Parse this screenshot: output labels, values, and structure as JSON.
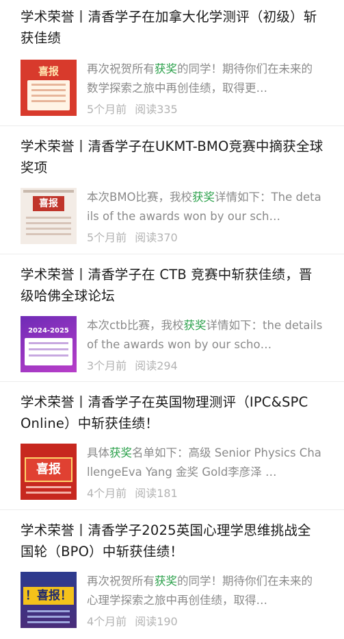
{
  "articles": [
    {
      "title": "学术荣誉丨清香学子在加拿大化学测评（初级）斩获佳绩",
      "summary_pre": "再次祝贺所有",
      "summary_hl": "获奖",
      "summary_post": "的同学！期待你们在未来的数学探索之旅中再创佳绩，取得更…",
      "time": "5个月前",
      "reads": "阅读335",
      "thumb_text": "喜报"
    },
    {
      "title": "学术荣誉丨清香学子在UKMT-BMO竞赛中摘获全球奖项",
      "summary_pre": "本次BMO比赛，我校",
      "summary_hl": "获奖",
      "summary_post": "详情如下：The details of the awards won by our sch…",
      "time": "5个月前",
      "reads": "阅读370",
      "thumb_text": "喜报"
    },
    {
      "title": "学术荣誉丨清香学子在 CTB 竞赛中斩获佳绩，晋级哈佛全球论坛",
      "summary_pre": "本次ctb比赛，我校",
      "summary_hl": "获奖",
      "summary_post": "详情如下：the details of the awards won by our scho…",
      "time": "3个月前",
      "reads": "阅读294",
      "thumb_text": "2024-2025"
    },
    {
      "title": "学术荣誉丨清香学子在英国物理测评（IPC&SPC Online）中斩获佳绩！",
      "summary_pre": "具体",
      "summary_hl": "获奖",
      "summary_post": "名单如下：高级 Senior Physics ChallengeEva Yang 金奖 Gold李彦泽 …",
      "time": "4个月前",
      "reads": "阅读181",
      "thumb_text": "喜报"
    },
    {
      "title": "学术荣誉丨清香学子2025英国心理学思维挑战全国轮（BPO）中斩获佳绩！",
      "summary_pre": "再次祝贺所有",
      "summary_hl": "获奖",
      "summary_post": "的同学！期待你们在未来的心理学探索之旅中再创佳绩，取得…",
      "time": "4个月前",
      "reads": "阅读190",
      "thumb_text": "！喜报！"
    }
  ],
  "colors": {
    "highlight": "#2aa04a",
    "summary": "#8a8a8a",
    "stats": "#b3b3b3"
  }
}
